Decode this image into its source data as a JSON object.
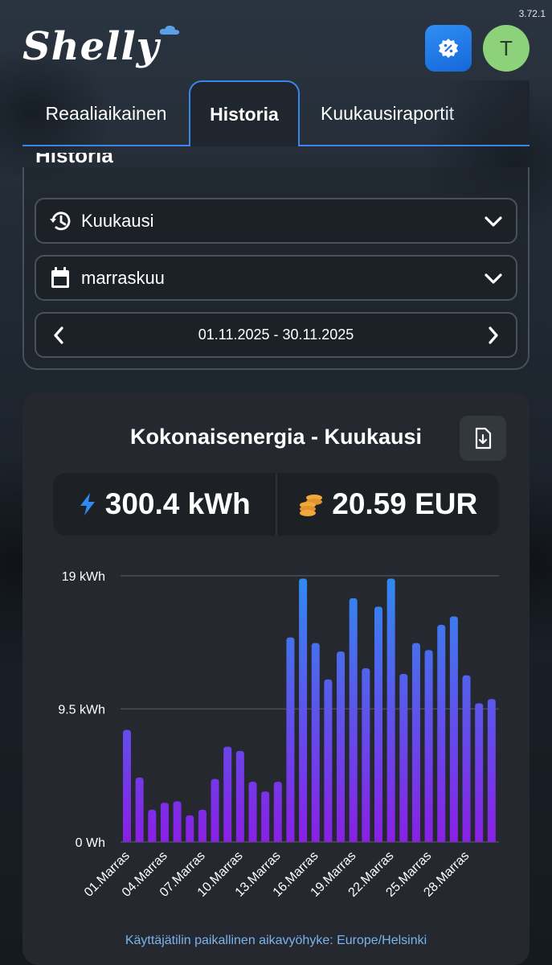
{
  "app": {
    "version": "3.72.1",
    "logo_text": "Shelly",
    "avatar_initial": "T"
  },
  "tabs": [
    {
      "label": "Reaaliaikainen",
      "active": false
    },
    {
      "label": "Historia",
      "active": true
    },
    {
      "label": "Kuukausiraportit",
      "active": false
    }
  ],
  "history": {
    "title": "Historia",
    "period_select": {
      "value": "Kuukausi",
      "icon": "history-icon"
    },
    "month_select": {
      "value": "marraskuu",
      "icon": "calendar-icon"
    },
    "range": {
      "label": "01.11.2025 - 30.11.2025"
    }
  },
  "card": {
    "title": "Kokonaisenergia - Kuukausi",
    "energy": "300.4 kWh",
    "cost": "20.59 EUR",
    "timezone_note": "Käyttäjätilin paikallinen aikavyöhyke: Europe/Helsinki"
  },
  "colors": {
    "accent": "#3a86e8",
    "bar_top": "#2f8bf0",
    "bar_bottom": "#8a1fe6",
    "coins": "#f2a83a"
  },
  "chart_data": {
    "type": "bar",
    "title": "",
    "xlabel": "",
    "ylabel": "",
    "ylim": [
      0,
      19
    ],
    "y_ticks": [
      "19 kWh",
      "9.5 kWh",
      "0 Wh"
    ],
    "y_tick_values": [
      19,
      9.5,
      0
    ],
    "unit": "kWh",
    "categories": [
      "01.Marras",
      "02.Marras",
      "03.Marras",
      "04.Marras",
      "05.Marras",
      "06.Marras",
      "07.Marras",
      "08.Marras",
      "09.Marras",
      "10.Marras",
      "11.Marras",
      "12.Marras",
      "13.Marras",
      "14.Marras",
      "15.Marras",
      "16.Marras",
      "17.Marras",
      "18.Marras",
      "19.Marras",
      "20.Marras",
      "21.Marras",
      "22.Marras",
      "23.Marras",
      "24.Marras",
      "25.Marras",
      "26.Marras",
      "27.Marras",
      "28.Marras",
      "29.Marras",
      "30.Marras"
    ],
    "x_tick_labels": [
      "01.Marras",
      "04.Marras",
      "07.Marras",
      "10.Marras",
      "13.Marras",
      "16.Marras",
      "19.Marras",
      "22.Marras",
      "25.Marras",
      "28.Marras"
    ],
    "values": [
      8.0,
      4.6,
      2.3,
      2.8,
      2.9,
      1.9,
      2.3,
      4.5,
      6.8,
      6.5,
      4.3,
      3.6,
      4.3,
      14.6,
      18.8,
      14.2,
      11.6,
      13.6,
      17.4,
      12.4,
      16.8,
      18.8,
      12.0,
      14.2,
      13.7,
      15.5,
      16.1,
      11.9,
      9.9,
      10.2
    ]
  }
}
